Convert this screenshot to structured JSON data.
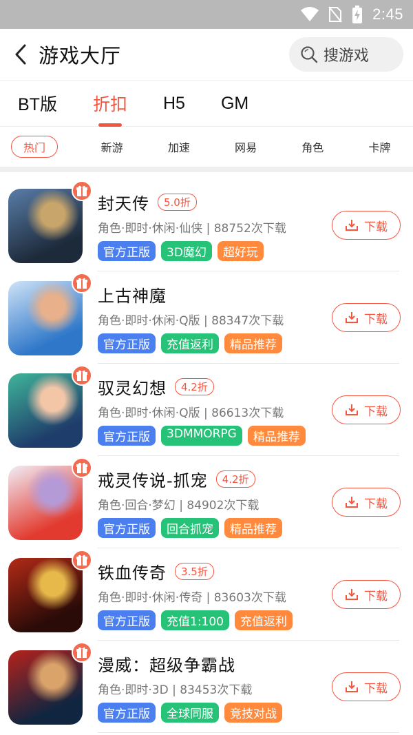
{
  "status_bar": {
    "time": "2:45"
  },
  "header": {
    "title": "游戏大厅",
    "search_placeholder": "搜游戏"
  },
  "tabs": [
    {
      "label": "BT版",
      "active": false
    },
    {
      "label": "折扣",
      "active": true
    },
    {
      "label": "H5",
      "active": false
    },
    {
      "label": "GM",
      "active": false
    }
  ],
  "filters": [
    {
      "label": "热门",
      "active": true
    },
    {
      "label": "新游"
    },
    {
      "label": "加速"
    },
    {
      "label": "网易"
    },
    {
      "label": "角色"
    },
    {
      "label": "卡牌"
    }
  ],
  "download_label": "下载",
  "games": [
    {
      "name": "封天传",
      "discount": "5.0折",
      "meta": "角色·即时·休闲·仙侠 | 88752次下载",
      "tags": [
        "官方正版",
        "3D魔幻",
        "超好玩"
      ],
      "icon_colors": [
        "#1d2a3a",
        "#5a7da8",
        "#c8a56a"
      ]
    },
    {
      "name": "上古神魔",
      "discount": "",
      "meta": "角色·即时·休闲·Q版 | 88347次下载",
      "tags": [
        "官方正版",
        "充值返利",
        "精品推荐"
      ],
      "icon_colors": [
        "#2e77c9",
        "#cfe3f7",
        "#e8b08b"
      ]
    },
    {
      "name": "驭灵幻想",
      "discount": "4.2折",
      "meta": "角色·即时·休闲·Q版 | 86613次下载",
      "tags": [
        "官方正版",
        "3DMMORPG",
        "精品推荐"
      ],
      "icon_colors": [
        "#1f3d6b",
        "#3fb59a",
        "#f3c6a8"
      ]
    },
    {
      "name": "戒灵传说-抓宠",
      "discount": "4.2折",
      "meta": "角色·回合·梦幻 | 84902次下载",
      "tags": [
        "官方正版",
        "回合抓宠",
        "精品推荐"
      ],
      "icon_colors": [
        "#e23a2e",
        "#f1eef7",
        "#b59ad8"
      ]
    },
    {
      "name": "铁血传奇",
      "discount": "3.5折",
      "meta": "角色·即时·休闲·传奇 | 83603次下载",
      "tags": [
        "官方正版",
        "充值1:100",
        "充值返利"
      ],
      "icon_colors": [
        "#2b0b08",
        "#b32a17",
        "#e7b84a"
      ]
    },
    {
      "name": "漫威：超级争霸战",
      "discount": "",
      "meta": "角色·即时·3D | 83453次下载",
      "tags": [
        "官方正版",
        "全球同服",
        "竞技对战"
      ],
      "icon_colors": [
        "#0f2540",
        "#b7221c",
        "#d9a36a"
      ]
    }
  ]
}
